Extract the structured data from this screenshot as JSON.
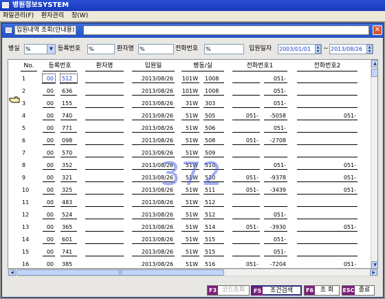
{
  "app": {
    "title": "병원정보SYSTEM"
  },
  "menu": [
    {
      "label": "화일관리(F)"
    },
    {
      "label": "환자관리"
    },
    {
      "label": "창(W)"
    }
  ],
  "window": {
    "title": "입원내역 조회(안내용)",
    "close_glyph": "✕"
  },
  "filters": {
    "ward_label": "병실",
    "ward_value": "%",
    "regno_label": "등록번호",
    "regno_value": "%",
    "name_label": "환자명",
    "name_value": "%",
    "phone_label": "전화번호",
    "phone_value": "%",
    "admit_label": "입원일자",
    "date_from": "2003/01/01",
    "date_sep": "~",
    "date_to": "2013/08/26"
  },
  "grid": {
    "headers": [
      "No.",
      "등록번호",
      "환자명",
      "입원일",
      "병동/실",
      "전화번호1",
      "전화번호2"
    ],
    "rows": [
      {
        "no": "1",
        "reg_a": "00",
        "reg_b": "512",
        "date": "2013/08/26",
        "ward": "101W",
        "room": "1008",
        "p1a": "",
        "p1b": "051-",
        "p2": ""
      },
      {
        "no": "2",
        "reg_a": "00",
        "reg_b": "636",
        "date": "2013/08/26",
        "ward": "101W",
        "room": "1008",
        "p1a": "",
        "p1b": "051-",
        "p2": ""
      },
      {
        "no": "3",
        "reg_a": "00",
        "reg_b": "155",
        "date": "2013/08/26",
        "ward": "31W",
        "room": "303",
        "p1a": "",
        "p1b": "051-",
        "p2": ""
      },
      {
        "no": "4",
        "reg_a": "00",
        "reg_b": "740",
        "date": "2013/08/26",
        "ward": "51W",
        "room": "505",
        "p1a": "051-",
        "p1b": "-5058",
        "p2": "051-"
      },
      {
        "no": "5",
        "reg_a": "00",
        "reg_b": "771",
        "date": "2013/08/26",
        "ward": "51W",
        "room": "506",
        "p1a": "",
        "p1b": "051-",
        "p2": ""
      },
      {
        "no": "6",
        "reg_a": "00",
        "reg_b": "098",
        "date": "2013/08/26",
        "ward": "51W",
        "room": "508",
        "p1a": "051-",
        "p1b": "-2708",
        "p2": ""
      },
      {
        "no": "7",
        "reg_a": "00",
        "reg_b": "570",
        "date": "2013/08/26",
        "ward": "51W",
        "room": "509",
        "p1a": "",
        "p1b": "",
        "p2": ""
      },
      {
        "no": "8",
        "reg_a": "00",
        "reg_b": "352",
        "date": "2013/08/26",
        "ward": "51W",
        "room": "510",
        "p1a": "",
        "p1b": "051-",
        "p2": "051-"
      },
      {
        "no": "9",
        "reg_a": "00",
        "reg_b": "321",
        "date": "2013/08/26",
        "ward": "51W",
        "room": "510",
        "p1a": "051-",
        "p1b": "-9378",
        "p2": "051-"
      },
      {
        "no": "10",
        "reg_a": "00",
        "reg_b": "325",
        "date": "2013/08/26",
        "ward": "51W",
        "room": "511",
        "p1a": "051-",
        "p1b": "-3439",
        "p2": "051-"
      },
      {
        "no": "11",
        "reg_a": "00",
        "reg_b": "483",
        "date": "2013/08/26",
        "ward": "51W",
        "room": "512",
        "p1a": "",
        "p1b": "",
        "p2": ""
      },
      {
        "no": "12",
        "reg_a": "00",
        "reg_b": "524",
        "date": "2013/08/26",
        "ward": "51W",
        "room": "512",
        "p1a": "",
        "p1b": "051-",
        "p2": ""
      },
      {
        "no": "13",
        "reg_a": "00",
        "reg_b": "365",
        "date": "2013/08/26",
        "ward": "51W",
        "room": "514",
        "p1a": "051-",
        "p1b": "-3930",
        "p2": "051-"
      },
      {
        "no": "14",
        "reg_a": "00",
        "reg_b": "601",
        "date": "2013/08/26",
        "ward": "51W",
        "room": "515",
        "p1a": "",
        "p1b": "051-",
        "p2": ""
      },
      {
        "no": "15",
        "reg_a": "00",
        "reg_b": "741",
        "date": "2013/08/26",
        "ward": "51W",
        "room": "515",
        "p1a": "",
        "p1b": "051-",
        "p2": ""
      },
      {
        "no": "16",
        "reg_a": "00",
        "reg_b": "385",
        "date": "2013/08/26",
        "ward": "51W",
        "room": "516",
        "p1a": "051-",
        "p1b": "-7204",
        "p2": "051-"
      }
    ],
    "overlay_count": "372",
    "pointer_icon": "pointing-hand-icon"
  },
  "buttons": [
    {
      "key": "F3",
      "label": "코드조회",
      "enabled": false
    },
    {
      "key": "F5",
      "label": "조건검색",
      "enabled": true
    },
    {
      "key": "F6",
      "label": "조 회",
      "enabled": true
    },
    {
      "key": "ESC",
      "label": "종료",
      "enabled": true
    }
  ],
  "colors": {
    "title_bar": "#2352c6",
    "key_badge": "#7b1f79",
    "overlay": "#5a6ee6",
    "date_text": "#1e3fd0"
  }
}
